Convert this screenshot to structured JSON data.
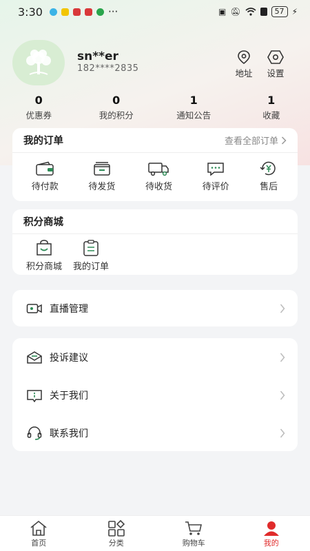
{
  "status_bar": {
    "time": "3:30",
    "dots": "···",
    "battery": "57"
  },
  "profile": {
    "username": "sn**er",
    "phone": "182****2835"
  },
  "top_actions": {
    "address": "地址",
    "settings": "设置"
  },
  "stats": [
    {
      "value": "0",
      "label": "优惠券"
    },
    {
      "value": "0",
      "label": "我的积分"
    },
    {
      "value": "1",
      "label": "通知公告"
    },
    {
      "value": "1",
      "label": "收藏"
    }
  ],
  "orders": {
    "title": "我的订单",
    "view_all": "查看全部订单",
    "items": [
      {
        "label": "待付款",
        "icon": "wallet-icon"
      },
      {
        "label": "待发货",
        "icon": "box-icon"
      },
      {
        "label": "待收货",
        "icon": "truck-icon"
      },
      {
        "label": "待评价",
        "icon": "comment-icon"
      },
      {
        "label": "售后",
        "icon": "yen-refund-icon"
      }
    ]
  },
  "points_mall": {
    "title": "积分商城",
    "items": [
      {
        "label": "积分商城",
        "icon": "shopping-bag-icon"
      },
      {
        "label": "我的订单",
        "icon": "clipboard-icon"
      }
    ]
  },
  "live": {
    "label": "直播管理",
    "icon": "video-camera-icon"
  },
  "menu": [
    {
      "label": "投诉建议",
      "icon": "mail-icon"
    },
    {
      "label": "关于我们",
      "icon": "info-icon"
    },
    {
      "label": "联系我们",
      "icon": "headset-icon"
    }
  ],
  "tabbar": [
    {
      "label": "首页",
      "icon": "home-icon"
    },
    {
      "label": "分类",
      "icon": "category-icon"
    },
    {
      "label": "购物车",
      "icon": "cart-icon"
    },
    {
      "label": "我的",
      "icon": "user-icon"
    }
  ],
  "colors": {
    "accent_green": "#2e8b57",
    "active_red": "#e02b2b"
  }
}
